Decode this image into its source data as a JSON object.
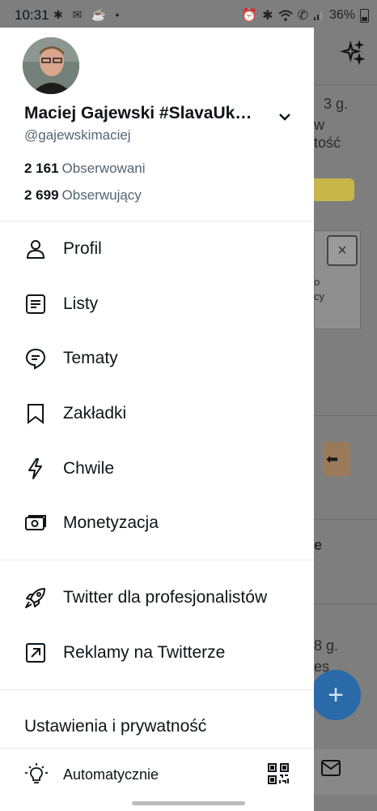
{
  "status_bar": {
    "time": "10:31",
    "left_icons": [
      "slack-icon",
      "missed-call-icon",
      "app-icon",
      "dot-icon"
    ],
    "right_icons": [
      "alarm-icon",
      "bluetooth-icon",
      "wifi-icon",
      "call-icon",
      "signal-icon"
    ],
    "battery": "36%"
  },
  "profile": {
    "display_name": "Maciej Gajewski #SlavaUk…",
    "handle": "@gajewskimaciej",
    "following_count": "2 161",
    "following_label": "Obserwowani",
    "followers_count": "2 699",
    "followers_label": "Obserwujący"
  },
  "menu": {
    "primary": [
      {
        "label": "Profil",
        "icon": "person-icon"
      },
      {
        "label": "Listy",
        "icon": "list-icon"
      },
      {
        "label": "Tematy",
        "icon": "topics-icon"
      },
      {
        "label": "Zakładki",
        "icon": "bookmark-icon"
      },
      {
        "label": "Chwile",
        "icon": "lightning-icon"
      },
      {
        "label": "Monetyzacja",
        "icon": "money-icon"
      }
    ],
    "secondary": [
      {
        "label": "Twitter dla profesjonalistów",
        "icon": "rocket-icon"
      },
      {
        "label": "Reklamy na Twitterze",
        "icon": "external-arrow-icon"
      }
    ]
  },
  "settings_label": "Ustawienia i prywatność",
  "display_mode_label": "Automatycznie",
  "background": {
    "text_1": "3 g.",
    "text_2": "w",
    "text_3": "tość",
    "text_4": "o",
    "text_5": "cy",
    "text_6": "e",
    "text_7": "8 g.",
    "text_8": "es"
  },
  "colors": {
    "accent": "#1d9bf0",
    "secondary_text": "#536471",
    "primary_text": "#0f1419"
  }
}
